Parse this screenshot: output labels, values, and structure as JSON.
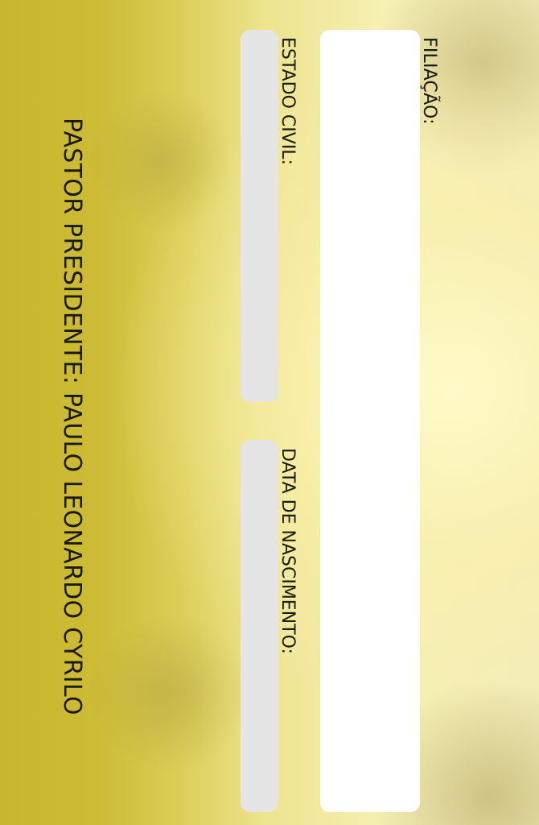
{
  "card": {
    "fields": {
      "filiacao": {
        "label": "FILIAÇÃO:",
        "value": ""
      },
      "estado_civil": {
        "label": "ESTADO CIVIL:",
        "value": ""
      },
      "data_nascimento": {
        "label": "DATA DE NASCIMENTO:",
        "value": ""
      }
    },
    "footer": {
      "pastor": "PASTOR PRESIDENTE: PAULO LEONARDO CYRILO"
    }
  },
  "colors": {
    "background_gold": "#c8b72e",
    "background_light": "#f6f0b4",
    "field_white": "#ffffff",
    "field_gray": "#e5e5e5",
    "text": "#1a1a14"
  }
}
